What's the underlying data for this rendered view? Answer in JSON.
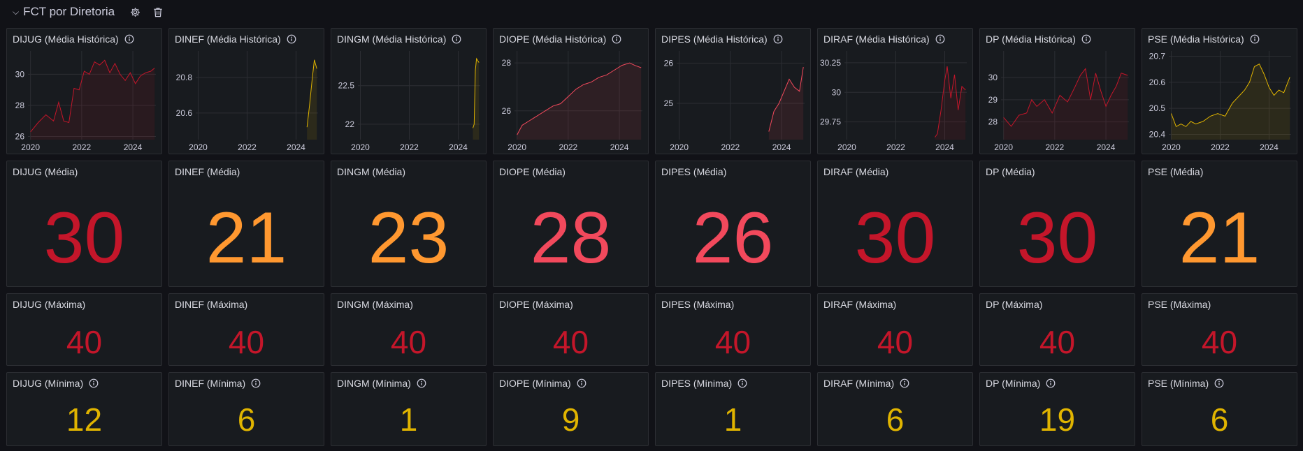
{
  "row": {
    "title": "FCT por Diretoria"
  },
  "colors": {
    "red": "#c4162a",
    "orange": "#ff9830",
    "coral": "#f2495c",
    "yellow": "#e0b400"
  },
  "historic_panels": [
    {
      "title": "DIJUG (Média Histórica)",
      "color": "#c4162a"
    },
    {
      "title": "DINEF (Média Histórica)",
      "color": "#e0b400"
    },
    {
      "title": "DINGM (Média Histórica)",
      "color": "#e0b400"
    },
    {
      "title": "DIOPE (Média Histórica)",
      "color": "#f2495c"
    },
    {
      "title": "DIPES (Média Histórica)",
      "color": "#f2495c"
    },
    {
      "title": "DIRAF (Média Histórica)",
      "color": "#c4162a"
    },
    {
      "title": "DP (Média Histórica)",
      "color": "#c4162a"
    },
    {
      "title": "PSE (Média Histórica)",
      "color": "#e0b400"
    }
  ],
  "chart_data": [
    {
      "type": "line",
      "title": "DIJUG (Média Histórica)",
      "xlim": [
        2019.9,
        2024.9
      ],
      "ylim": [
        25.8,
        31.5
      ],
      "x_ticks": [
        2020,
        2022,
        2024
      ],
      "y_ticks": [
        26,
        28,
        30
      ],
      "grid": true,
      "x": [
        2020,
        2020.3,
        2020.6,
        2020.9,
        2021.1,
        2021.3,
        2021.5,
        2021.7,
        2021.9,
        2022.1,
        2022.3,
        2022.5,
        2022.7,
        2022.9,
        2023.1,
        2023.3,
        2023.5,
        2023.7,
        2023.9,
        2024.1,
        2024.3,
        2024.5,
        2024.7,
        2024.85
      ],
      "y": [
        26.3,
        26.9,
        27.4,
        27.0,
        28.2,
        27.0,
        26.9,
        29.1,
        29.0,
        30.2,
        30.0,
        30.8,
        30.6,
        30.9,
        30.1,
        30.7,
        30.0,
        29.6,
        30.1,
        29.4,
        29.9,
        30.1,
        30.2,
        30.4
      ]
    },
    {
      "type": "line",
      "title": "DINEF (Média Histórica)",
      "xlim": [
        2019.9,
        2024.9
      ],
      "ylim": [
        20.45,
        20.95
      ],
      "x_ticks": [
        2020,
        2022,
        2024
      ],
      "y_ticks": [
        20.6,
        20.8
      ],
      "grid": true,
      "x": [
        2024.45,
        2024.55,
        2024.65,
        2024.75,
        2024.85
      ],
      "y": [
        20.52,
        20.64,
        20.78,
        20.9,
        20.85
      ]
    },
    {
      "type": "line",
      "title": "DINGM (Média Histórica)",
      "xlim": [
        2019.9,
        2024.9
      ],
      "ylim": [
        21.8,
        22.95
      ],
      "x_ticks": [
        2020,
        2022,
        2024
      ],
      "y_ticks": [
        22,
        22.5
      ],
      "grid": true,
      "x": [
        2024.6,
        2024.65,
        2024.7,
        2024.75,
        2024.85
      ],
      "y": [
        21.95,
        22.0,
        22.7,
        22.85,
        22.8
      ]
    },
    {
      "type": "line",
      "title": "DIOPE (Média Histórica)",
      "xlim": [
        2019.9,
        2024.9
      ],
      "ylim": [
        24.8,
        28.5
      ],
      "x_ticks": [
        2020,
        2022,
        2024
      ],
      "y_ticks": [
        26,
        28
      ],
      "grid": true,
      "x": [
        2020,
        2020.2,
        2020.5,
        2020.8,
        2021.1,
        2021.4,
        2021.7,
        2022,
        2022.3,
        2022.6,
        2022.9,
        2023.2,
        2023.5,
        2023.8,
        2024.1,
        2024.4,
        2024.6,
        2024.85
      ],
      "y": [
        25.0,
        25.4,
        25.6,
        25.8,
        26.0,
        26.2,
        26.3,
        26.6,
        26.9,
        27.1,
        27.2,
        27.4,
        27.5,
        27.7,
        27.9,
        28.0,
        27.9,
        27.8
      ]
    },
    {
      "type": "line",
      "title": "DIPES (Média Histórica)",
      "xlim": [
        2019.9,
        2024.9
      ],
      "ylim": [
        24.1,
        26.3
      ],
      "x_ticks": [
        2020,
        2022,
        2024
      ],
      "y_ticks": [
        25,
        26
      ],
      "grid": true,
      "x": [
        2023.5,
        2023.7,
        2023.9,
        2024.1,
        2024.3,
        2024.5,
        2024.7,
        2024.85
      ],
      "y": [
        24.3,
        24.8,
        25.0,
        25.3,
        25.6,
        25.4,
        25.3,
        25.9
      ]
    },
    {
      "type": "line",
      "title": "DIRAF (Média Histórica)",
      "xlim": [
        2019.9,
        2024.9
      ],
      "ylim": [
        29.6,
        30.35
      ],
      "x_ticks": [
        2020,
        2022,
        2024
      ],
      "y_ticks": [
        29.75,
        30,
        30.25
      ],
      "grid": true,
      "x": [
        2023.6,
        2023.7,
        2023.85,
        2024.0,
        2024.1,
        2024.25,
        2024.4,
        2024.55,
        2024.7,
        2024.85
      ],
      "y": [
        29.62,
        29.65,
        29.85,
        30.1,
        30.22,
        29.95,
        30.15,
        29.85,
        30.05,
        30.02
      ]
    },
    {
      "type": "line",
      "title": "DP (Média Histórica)",
      "xlim": [
        2019.9,
        2024.9
      ],
      "ylim": [
        27.2,
        31.2
      ],
      "x_ticks": [
        2020,
        2022,
        2024
      ],
      "y_ticks": [
        28,
        29,
        30
      ],
      "grid": true,
      "x": [
        2020,
        2020.3,
        2020.6,
        2020.9,
        2021.1,
        2021.3,
        2021.6,
        2021.9,
        2022.2,
        2022.5,
        2022.8,
        2023.0,
        2023.2,
        2023.4,
        2023.6,
        2023.8,
        2024.0,
        2024.2,
        2024.4,
        2024.6,
        2024.85
      ],
      "y": [
        28.2,
        27.8,
        28.3,
        28.4,
        29.0,
        28.7,
        29.0,
        28.4,
        29.2,
        28.9,
        29.6,
        30.1,
        30.4,
        29.0,
        30.2,
        29.4,
        28.7,
        29.2,
        29.6,
        30.2,
        30.1
      ]
    },
    {
      "type": "line",
      "title": "PSE (Média Histórica)",
      "xlim": [
        2019.9,
        2024.9
      ],
      "ylim": [
        20.38,
        20.72
      ],
      "x_ticks": [
        2020,
        2022,
        2024
      ],
      "y_ticks": [
        20.4,
        20.5,
        20.6,
        20.7
      ],
      "grid": true,
      "x": [
        2020,
        2020.2,
        2020.4,
        2020.6,
        2020.8,
        2021,
        2021.3,
        2021.6,
        2021.9,
        2022.2,
        2022.5,
        2022.8,
        2023.0,
        2023.2,
        2023.4,
        2023.6,
        2023.8,
        2024.0,
        2024.2,
        2024.4,
        2024.6,
        2024.85
      ],
      "y": [
        20.48,
        20.43,
        20.44,
        20.43,
        20.45,
        20.44,
        20.45,
        20.47,
        20.48,
        20.47,
        20.52,
        20.55,
        20.57,
        20.6,
        20.66,
        20.67,
        20.63,
        20.58,
        20.55,
        20.57,
        20.56,
        20.62
      ]
    }
  ],
  "mean_panels": [
    {
      "title": "DIJUG (Média)",
      "value": "30",
      "color": "#c4162a"
    },
    {
      "title": "DINEF (Média)",
      "value": "21",
      "color": "#ff9830"
    },
    {
      "title": "DINGM (Média)",
      "value": "23",
      "color": "#ff9830"
    },
    {
      "title": "DIOPE (Média)",
      "value": "28",
      "color": "#f2495c"
    },
    {
      "title": "DIPES (Média)",
      "value": "26",
      "color": "#f2495c"
    },
    {
      "title": "DIRAF (Média)",
      "value": "30",
      "color": "#c4162a"
    },
    {
      "title": "DP (Média)",
      "value": "30",
      "color": "#c4162a"
    },
    {
      "title": "PSE (Média)",
      "value": "21",
      "color": "#ff9830"
    }
  ],
  "max_panels": [
    {
      "title": "DIJUG (Máxima)",
      "value": "40",
      "color": "#c4162a"
    },
    {
      "title": "DINEF (Máxima)",
      "value": "40",
      "color": "#c4162a"
    },
    {
      "title": "DINGM (Máxima)",
      "value": "40",
      "color": "#c4162a"
    },
    {
      "title": "DIOPE (Máxima)",
      "value": "40",
      "color": "#c4162a"
    },
    {
      "title": "DIPES (Máxima)",
      "value": "40",
      "color": "#c4162a"
    },
    {
      "title": "DIRAF (Máxima)",
      "value": "40",
      "color": "#c4162a"
    },
    {
      "title": "DP (Máxima)",
      "value": "40",
      "color": "#c4162a"
    },
    {
      "title": "PSE (Máxima)",
      "value": "40",
      "color": "#c4162a"
    }
  ],
  "min_panels": [
    {
      "title": "DIJUG (Mínima)",
      "value": "12",
      "color": "#e0b400"
    },
    {
      "title": "DINEF (Mínima)",
      "value": "6",
      "color": "#e0b400"
    },
    {
      "title": "DINGM (Mínima)",
      "value": "1",
      "color": "#e0b400"
    },
    {
      "title": "DIOPE (Mínima)",
      "value": "9",
      "color": "#e0b400"
    },
    {
      "title": "DIPES (Mínima)",
      "value": "1",
      "color": "#e0b400"
    },
    {
      "title": "DIRAF (Mínima)",
      "value": "6",
      "color": "#e0b400"
    },
    {
      "title": "DP (Mínima)",
      "value": "19",
      "color": "#e0b400"
    },
    {
      "title": "PSE (Mínima)",
      "value": "6",
      "color": "#e0b400"
    }
  ]
}
